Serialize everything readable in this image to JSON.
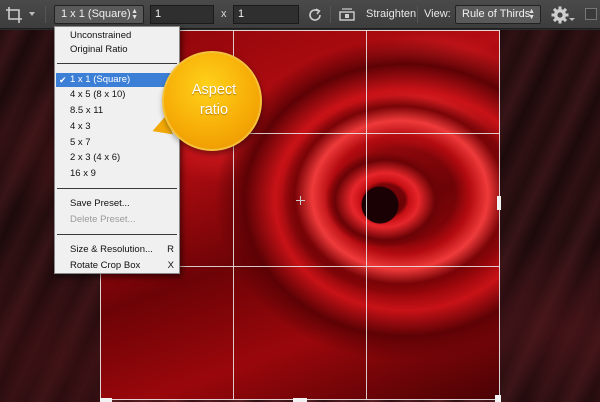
{
  "toolbar": {
    "tool_icon": "crop-tool-icon",
    "aspect_select": "1 x 1 (Square)",
    "width_value": "1",
    "times_label": "x",
    "height_value": "1",
    "swap_icon": "rotate-swap-icon",
    "straighten_icon": "level-icon",
    "straighten_label": "Straighten",
    "view_label": "View:",
    "overlay_select": "Rule of Thirds",
    "settings_icon": "gear-icon",
    "delete_cropped_checked": false
  },
  "menu": {
    "items_top": [
      "Unconstrained",
      "Original Ratio"
    ],
    "presets": [
      "1 x 1 (Square)",
      "4 x 5 (8 x 10)",
      "8.5 x 11",
      "4 x 3",
      "5 x 7",
      "2 x 3 (4 x 6)",
      "16 x 9"
    ],
    "selected_preset": "1 x 1 (Square)",
    "save_preset": "Save Preset...",
    "delete_preset": "Delete Preset...",
    "size_resolution": "Size & Resolution...",
    "size_resolution_shortcut": "R",
    "rotate_crop_box": "Rotate Crop Box",
    "rotate_crop_box_shortcut": "X"
  },
  "callout": {
    "line1": "Aspect",
    "line2": "ratio"
  },
  "colors": {
    "menu_highlight": "#3c7fd6",
    "callout_fill": "#f7ad07"
  }
}
